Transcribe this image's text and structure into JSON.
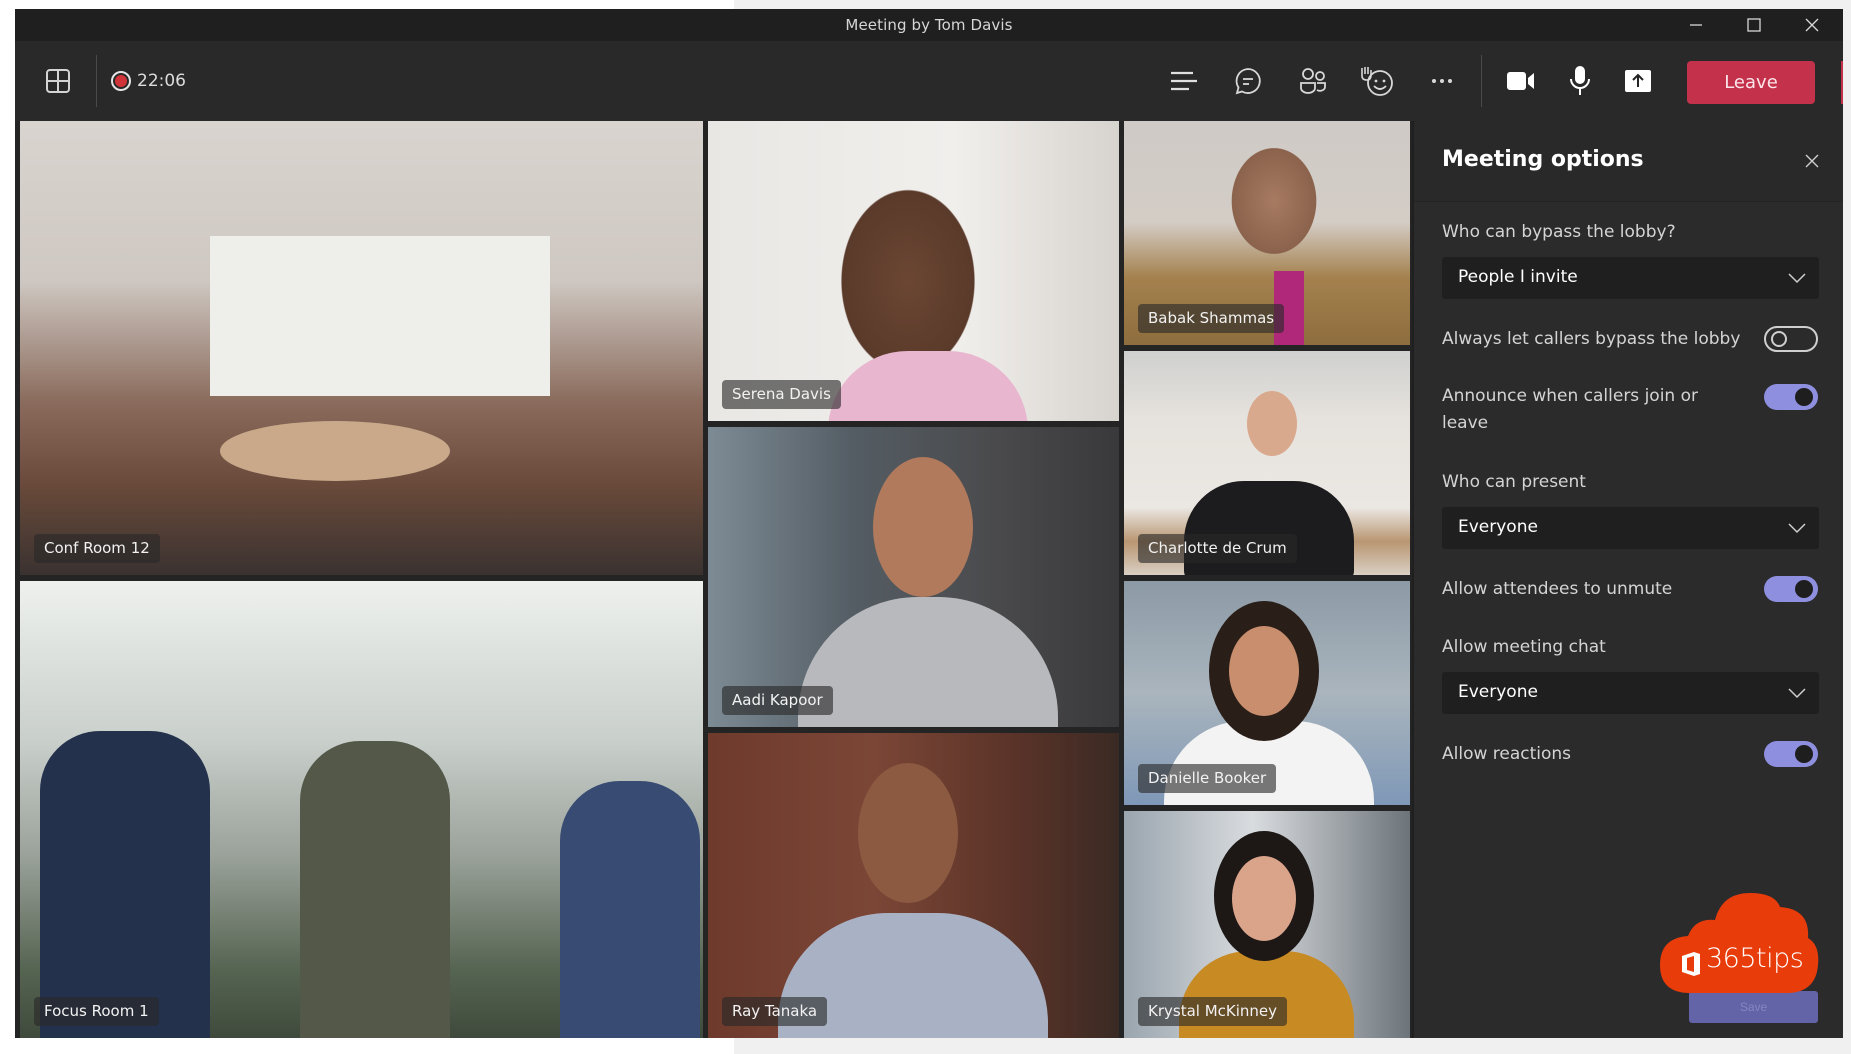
{
  "window": {
    "title": "Meeting by Tom Davis",
    "controls": [
      {
        "name": "minimize",
        "icon": "minimize-icon"
      },
      {
        "name": "maximize",
        "icon": "maximize-icon"
      },
      {
        "name": "close",
        "icon": "close-icon"
      }
    ]
  },
  "toolbar": {
    "layout_icon": "grid-layout-icon",
    "recording": {
      "icon": "record-icon",
      "elapsed": "22:06",
      "color": "#d13438"
    },
    "actions": [
      {
        "name": "meeting-details",
        "icon": "menu-lines-icon"
      },
      {
        "name": "chat",
        "icon": "chat-bubble-icon"
      },
      {
        "name": "participants",
        "icon": "people-icon"
      },
      {
        "name": "reactions",
        "icon": "raise-hand-smile-icon"
      },
      {
        "name": "more-actions",
        "icon": "more-ellipsis-icon"
      }
    ],
    "media": [
      {
        "name": "camera",
        "icon": "video-camera-icon"
      },
      {
        "name": "microphone",
        "icon": "microphone-icon"
      },
      {
        "name": "share",
        "icon": "share-screen-icon"
      }
    ],
    "leave_label": "Leave",
    "leave_color": "#c4314b"
  },
  "participants": [
    {
      "name": "Conf Room 12"
    },
    {
      "name": "Serena Davis"
    },
    {
      "name": "Babak Shammas"
    },
    {
      "name": "Charlotte de Crum"
    },
    {
      "name": "Aadi Kapoor"
    },
    {
      "name": "Danielle Booker"
    },
    {
      "name": "Focus Room 1"
    },
    {
      "name": "Ray Tanaka"
    },
    {
      "name": "Krystal McKinney"
    }
  ],
  "panel": {
    "title": "Meeting options",
    "lobby_label": "Who can bypass the lobby?",
    "lobby_value": "People I invite",
    "callers_bypass_label": "Always let callers bypass the lobby",
    "callers_bypass_on": false,
    "announce_label": "Announce when callers join or leave",
    "announce_on": true,
    "present_label": "Who can present",
    "present_value": "Everyone",
    "unmute_label": "Allow attendees to unmute",
    "unmute_on": true,
    "chat_label": "Allow meeting chat",
    "chat_value": "Everyone",
    "reactions_label": "Allow reactions",
    "reactions_on": true,
    "save_label": "Save",
    "accent_color": "#8f8fe0"
  },
  "watermark": {
    "text": "365tips",
    "color": "#e83c0b"
  }
}
